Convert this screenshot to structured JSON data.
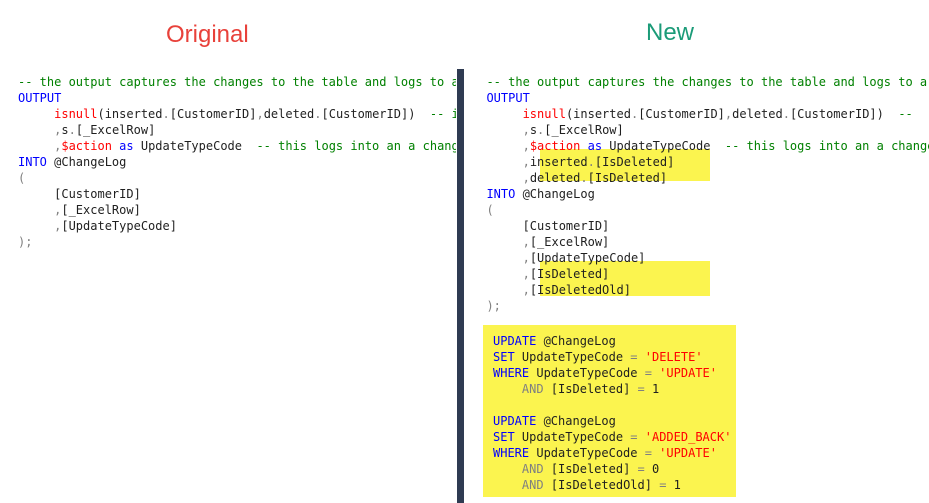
{
  "colors": {
    "title_original": "#e8413a",
    "title_new": "#1b9b78",
    "keyword": "#0000ff",
    "comment": "#008000",
    "text": "#1f1f1f",
    "gray": "#808080",
    "variable": "#ff0000",
    "string": "#ff0000",
    "highlight": "#fbf44f",
    "divider": "#2f3b52"
  },
  "titles": {
    "original": "Original",
    "new": "New"
  },
  "left_lines": [
    [
      {
        "t": "-- the output captures the changes to the table and logs to a t",
        "c": "comment"
      }
    ],
    [
      {
        "t": "OUTPUT",
        "c": "keyword"
      }
    ],
    [
      {
        "t": "     "
      },
      {
        "t": "isnull",
        "c": "variable"
      },
      {
        "t": "(inserted",
        "c": "text"
      },
      {
        "t": ".",
        "c": "gray"
      },
      {
        "t": "[CustomerID]",
        "c": "text"
      },
      {
        "t": ",",
        "c": "gray"
      },
      {
        "t": "deleted",
        "c": "text"
      },
      {
        "t": ".",
        "c": "gray"
      },
      {
        "t": "[CustomerID])",
        "c": "text"
      },
      {
        "t": "  -- inc",
        "c": "comment"
      }
    ],
    [
      {
        "t": "     "
      },
      {
        "t": ",",
        "c": "gray"
      },
      {
        "t": "s",
        "c": "text"
      },
      {
        "t": ".",
        "c": "gray"
      },
      {
        "t": "[_ExcelRow]",
        "c": "text"
      }
    ],
    [
      {
        "t": "     "
      },
      {
        "t": ",",
        "c": "gray"
      },
      {
        "t": "$action",
        "c": "variable"
      },
      {
        "t": " as ",
        "c": "keyword"
      },
      {
        "t": "UpdateTypeCode",
        "c": "text"
      },
      {
        "t": "  -- this logs into an a change",
        "c": "comment"
      }
    ],
    [
      {
        "t": "INTO",
        "c": "keyword"
      },
      {
        "t": " @ChangeLog",
        "c": "text"
      }
    ],
    [
      {
        "t": "(",
        "c": "gray"
      }
    ],
    [
      {
        "t": "     "
      },
      {
        "t": "[CustomerID]",
        "c": "text"
      }
    ],
    [
      {
        "t": "     "
      },
      {
        "t": ",",
        "c": "gray"
      },
      {
        "t": "[_ExcelRow]",
        "c": "text"
      }
    ],
    [
      {
        "t": "     "
      },
      {
        "t": ",",
        "c": "gray"
      },
      {
        "t": "[UpdateTypeCode]",
        "c": "text"
      }
    ],
    [
      {
        "t": ");",
        "c": "gray"
      }
    ]
  ],
  "right_lines": [
    [
      {
        "t": "  -- the output captures the changes to the table and logs to a t",
        "c": "comment"
      }
    ],
    [
      {
        "t": "  "
      },
      {
        "t": "OUTPUT",
        "c": "keyword"
      }
    ],
    [
      {
        "t": "       "
      },
      {
        "t": "isnull",
        "c": "variable"
      },
      {
        "t": "(inserted",
        "c": "text"
      },
      {
        "t": ".",
        "c": "gray"
      },
      {
        "t": "[CustomerID]",
        "c": "text"
      },
      {
        "t": ",",
        "c": "gray"
      },
      {
        "t": "deleted",
        "c": "text"
      },
      {
        "t": ".",
        "c": "gray"
      },
      {
        "t": "[CustomerID])",
        "c": "text"
      },
      {
        "t": "  --",
        "c": "comment"
      }
    ],
    [
      {
        "t": "       "
      },
      {
        "t": ",",
        "c": "gray"
      },
      {
        "t": "s",
        "c": "text"
      },
      {
        "t": ".",
        "c": "gray"
      },
      {
        "t": "[_ExcelRow]",
        "c": "text"
      }
    ],
    [
      {
        "t": "       "
      },
      {
        "t": ",",
        "c": "gray"
      },
      {
        "t": "$action",
        "c": "variable"
      },
      {
        "t": " as ",
        "c": "keyword"
      },
      {
        "t": "UpdateTypeCode",
        "c": "text"
      },
      {
        "t": "  -- this logs into an a change",
        "c": "comment"
      }
    ],
    [
      {
        "t": "       "
      },
      {
        "t": ",",
        "c": "gray"
      },
      {
        "t": "inserted",
        "c": "text"
      },
      {
        "t": ".",
        "c": "gray"
      },
      {
        "t": "[IsDeleted]",
        "c": "text"
      }
    ],
    [
      {
        "t": "       "
      },
      {
        "t": ",",
        "c": "gray"
      },
      {
        "t": "deleted",
        "c": "text"
      },
      {
        "t": ".",
        "c": "gray"
      },
      {
        "t": "[IsDeleted]",
        "c": "text"
      }
    ],
    [
      {
        "t": "  "
      },
      {
        "t": "INTO",
        "c": "keyword"
      },
      {
        "t": " @ChangeLog",
        "c": "text"
      }
    ],
    [
      {
        "t": "  "
      },
      {
        "t": "(",
        "c": "gray"
      }
    ],
    [
      {
        "t": "       "
      },
      {
        "t": "[CustomerID]",
        "c": "text"
      }
    ],
    [
      {
        "t": "       "
      },
      {
        "t": ",",
        "c": "gray"
      },
      {
        "t": "[_ExcelRow]",
        "c": "text"
      }
    ],
    [
      {
        "t": "       "
      },
      {
        "t": ",",
        "c": "gray"
      },
      {
        "t": "[UpdateTypeCode]",
        "c": "text"
      }
    ],
    [
      {
        "t": "       "
      },
      {
        "t": ",",
        "c": "gray"
      },
      {
        "t": "[IsDeleted]",
        "c": "text"
      }
    ],
    [
      {
        "t": "       "
      },
      {
        "t": ",",
        "c": "gray"
      },
      {
        "t": "[IsDeletedOld]",
        "c": "text"
      }
    ],
    [
      {
        "t": "  "
      },
      {
        "t": ");",
        "c": "gray"
      }
    ]
  ],
  "update_lines": [
    [
      {
        "t": "UPDATE",
        "c": "keyword"
      },
      {
        "t": " @ChangeLog",
        "c": "text"
      }
    ],
    [
      {
        "t": "SET",
        "c": "keyword"
      },
      {
        "t": " UpdateTypeCode ",
        "c": "text"
      },
      {
        "t": "=",
        "c": "gray"
      },
      {
        "t": " 'DELETE'",
        "c": "string"
      }
    ],
    [
      {
        "t": "WHERE",
        "c": "keyword"
      },
      {
        "t": " UpdateTypeCode ",
        "c": "text"
      },
      {
        "t": "=",
        "c": "gray"
      },
      {
        "t": " 'UPDATE'",
        "c": "string"
      }
    ],
    [
      {
        "t": "    "
      },
      {
        "t": "AND",
        "c": "gray"
      },
      {
        "t": " [IsDeleted] ",
        "c": "text"
      },
      {
        "t": "=",
        "c": "gray"
      },
      {
        "t": " 1",
        "c": "text"
      }
    ],
    [
      {
        "t": ""
      }
    ],
    [
      {
        "t": "UPDATE",
        "c": "keyword"
      },
      {
        "t": " @ChangeLog",
        "c": "text"
      }
    ],
    [
      {
        "t": "SET",
        "c": "keyword"
      },
      {
        "t": " UpdateTypeCode ",
        "c": "text"
      },
      {
        "t": "=",
        "c": "gray"
      },
      {
        "t": " 'ADDED_BACK'",
        "c": "string"
      }
    ],
    [
      {
        "t": "WHERE",
        "c": "keyword"
      },
      {
        "t": " UpdateTypeCode ",
        "c": "text"
      },
      {
        "t": "=",
        "c": "gray"
      },
      {
        "t": " 'UPDATE'",
        "c": "string"
      }
    ],
    [
      {
        "t": "    "
      },
      {
        "t": "AND",
        "c": "gray"
      },
      {
        "t": " [IsDeleted] ",
        "c": "text"
      },
      {
        "t": "=",
        "c": "gray"
      },
      {
        "t": " 0",
        "c": "text"
      }
    ],
    [
      {
        "t": "    "
      },
      {
        "t": "AND",
        "c": "gray"
      },
      {
        "t": " [IsDeletedOld] ",
        "c": "text"
      },
      {
        "t": "=",
        "c": "gray"
      },
      {
        "t": " 1",
        "c": "text"
      }
    ]
  ]
}
